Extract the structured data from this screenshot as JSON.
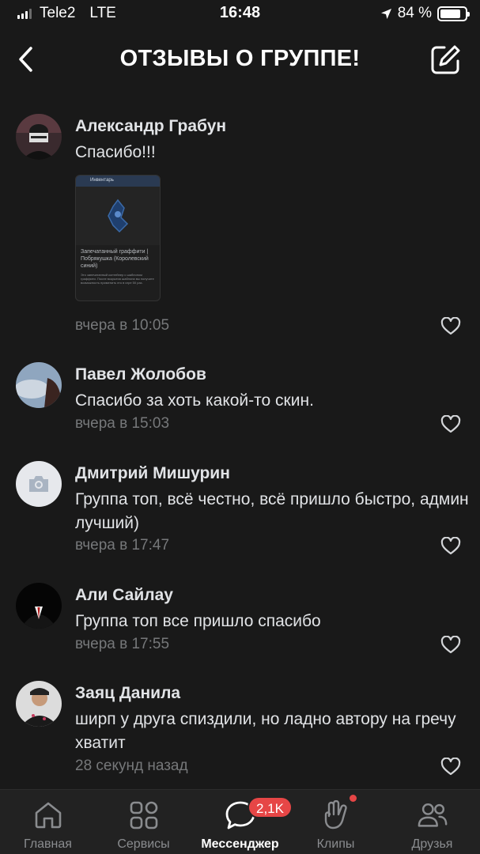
{
  "status_bar": {
    "carrier": "Tele2",
    "network": "LTE",
    "time": "16:48",
    "battery": "84 %",
    "battery_level": 0.84
  },
  "header": {
    "title": "ОТЗЫВЫ О ГРУППЕ!",
    "back_icon": "chevron-left-icon",
    "edit_icon": "compose-icon"
  },
  "comments": [
    {
      "author": "Александр Грабун",
      "text": "Спасибо!!!",
      "time": "вчера в 10:05",
      "attachment": {
        "header": "Инвентарь",
        "caption": "Запечатанный граффити | Побрякушка (Королевский синий)",
        "description": "Это запечатанный контейнер с шаблоном граффити. После вскрытия шаблона вы получите возможность применить его в игре 50 раз."
      }
    },
    {
      "author": "Павел Жолобов",
      "text": "Спасибо за хоть какой-то скин.",
      "time": "вчера в 15:03"
    },
    {
      "author": "Дмитрий Мишурин",
      "text": "Группа топ, всё честно, всё пришло быстро, админ лучший)",
      "time": "вчера в 17:47"
    },
    {
      "author": "Али Сайлау",
      "text": "Группа топ все пришло спасибо",
      "time": "вчера в 17:55"
    },
    {
      "author": "Заяц Данила",
      "text": "ширп у друга спиздили, но ладно автору на гречу хватит",
      "time": "28 секунд назад"
    }
  ],
  "tabbar": {
    "tabs": [
      {
        "label": "Главная",
        "icon": "home-icon"
      },
      {
        "label": "Сервисы",
        "icon": "services-icon"
      },
      {
        "label": "Мессенджер",
        "icon": "messenger-icon",
        "active": true
      },
      {
        "label": "Клипы",
        "icon": "clips-icon"
      },
      {
        "label": "Друзья",
        "icon": "friends-icon"
      }
    ],
    "messenger_badge": "2,1K"
  },
  "colors": {
    "background": "#191919",
    "text": "#e1e3e6",
    "secondary": "#76787a",
    "badge": "#e64646"
  }
}
